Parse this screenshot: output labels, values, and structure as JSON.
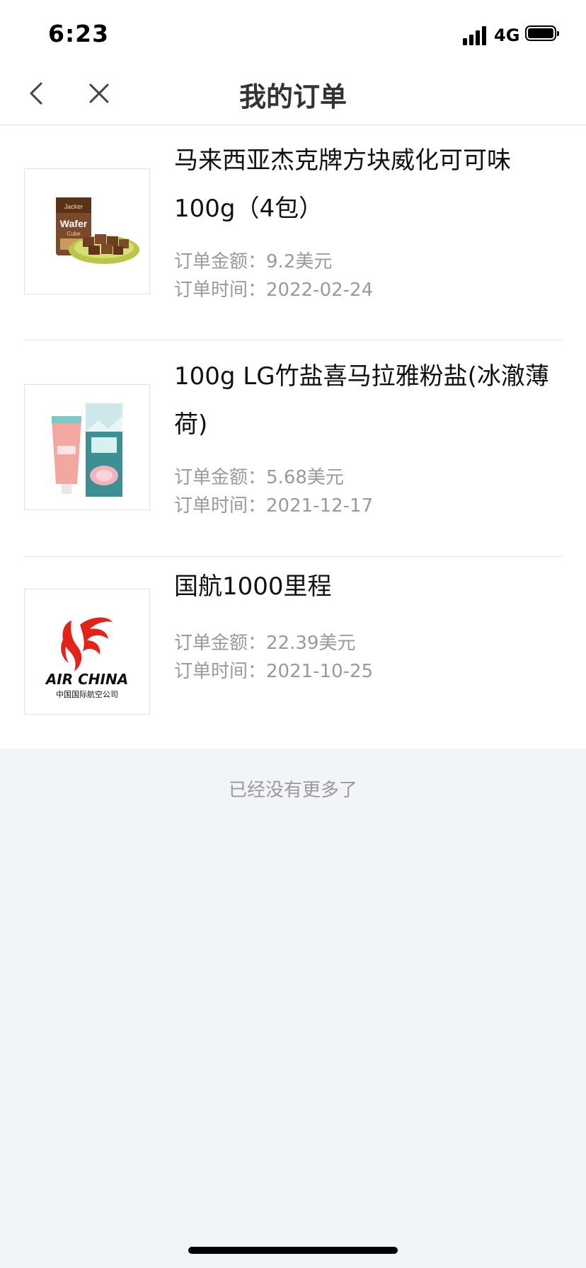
{
  "status_bar": {
    "time": "6:23",
    "network": "4G",
    "icons": [
      "signal-icon",
      "battery-icon"
    ]
  },
  "nav": {
    "title": "我的订单",
    "back_icon": "chevron-left-icon",
    "close_icon": "close-icon"
  },
  "orders": [
    {
      "name": "马来西亚杰克牌方块威化可可味100g（4包）",
      "amount_label": "订单金额：",
      "amount": "9.2美元",
      "time_label": "订单时间：",
      "time": "2022-02-24",
      "thumb_text_brand": "Jacker",
      "thumb_text_product": "Wafer",
      "thumb_text_sub": "Cube"
    },
    {
      "name": "100g LG竹盐喜马拉雅粉盐(冰澈薄荷)",
      "amount_label": "订单金额：",
      "amount": "5.68美元",
      "time_label": "订单时间：",
      "time": "2021-12-17"
    },
    {
      "name": "国航1000里程",
      "amount_label": "订单金额：",
      "amount": "22.39美元",
      "time_label": "订单时间：",
      "time": "2021-10-25",
      "thumb_text_en": "AIR CHINA",
      "thumb_text_cn": "中国国际航空公司"
    }
  ],
  "footer": {
    "no_more": "已经没有更多了"
  },
  "colors": {
    "background": "#f2f5f8",
    "card": "#ffffff",
    "meta_text": "#9a9a9a",
    "air_china_red": "#e2231a"
  }
}
